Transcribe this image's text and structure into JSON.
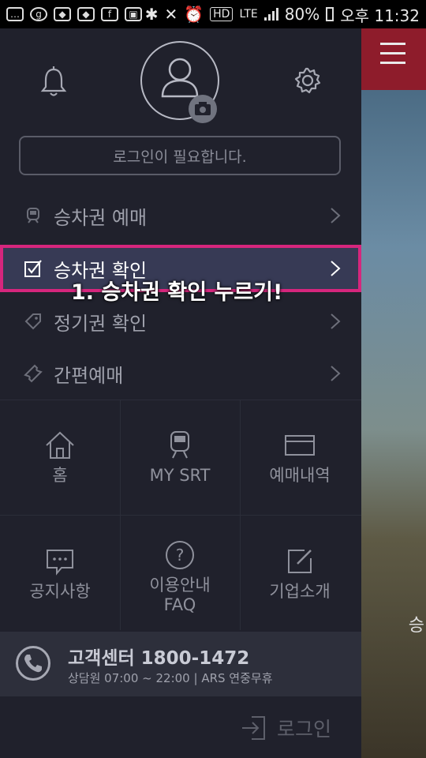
{
  "status_bar": {
    "battery": "80%",
    "time": "오후 11:32",
    "hd": "HD",
    "lte": "LTE"
  },
  "drawer": {
    "login_notice": "로그인이 필요합니다.",
    "menu": [
      {
        "label": "승차권 예매"
      },
      {
        "label": "승차권 확인"
      },
      {
        "label": "정기권 확인"
      },
      {
        "label": "간편예매"
      }
    ],
    "annotation": "1. 승차권 확인 누르기!",
    "grid": [
      {
        "label": "홈",
        "icon": "home-icon"
      },
      {
        "label": "MY SRT",
        "icon": "train-icon"
      },
      {
        "label": "예매내역",
        "icon": "card-icon"
      },
      {
        "label": "공지사항",
        "icon": "chat-icon"
      },
      {
        "label": "이용안내\nFAQ",
        "icon": "question-icon"
      },
      {
        "label": "기업소개",
        "icon": "edit-icon"
      }
    ],
    "support": {
      "title": "고객센터 1800-1472",
      "subtitle": "상담원  07:00 ~ 22:00  |  ARS  연중무휴"
    },
    "logout_label": "로그인"
  },
  "background": {
    "peek_text": "승"
  },
  "colors": {
    "drawer_bg": "#20212c",
    "highlight": "#d6267d",
    "header_red": "#8e1c2b"
  }
}
